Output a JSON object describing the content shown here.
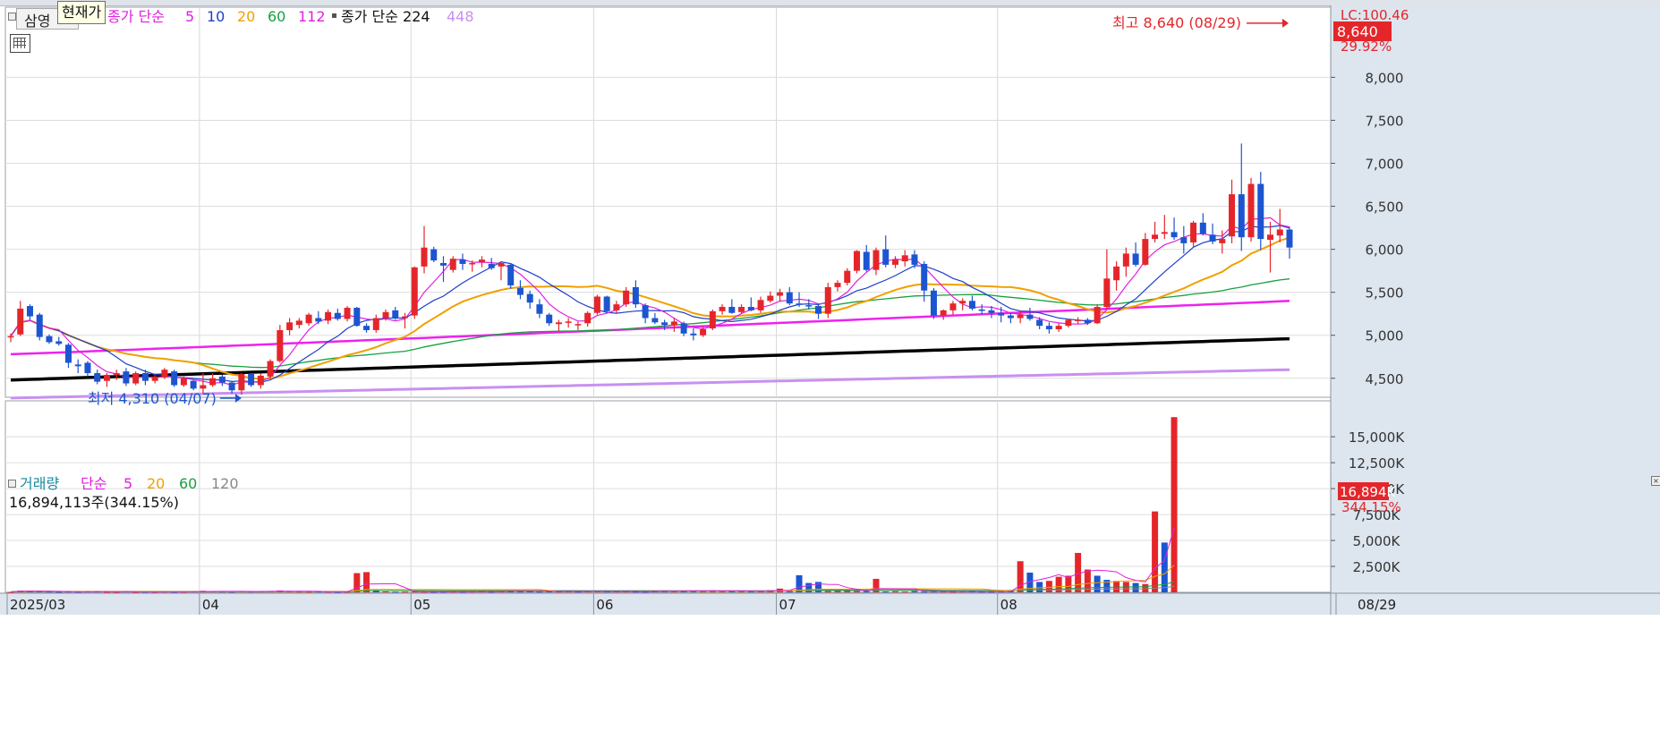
{
  "price_panel": {
    "title": "삼영",
    "tooltip": "현재가",
    "legend_ma_prefix": "종가 단순",
    "legend_ma_periods": [
      {
        "label": "5",
        "color": "#e020e0"
      },
      {
        "label": "10",
        "color": "#1e3fc8"
      },
      {
        "label": "20",
        "color": "#f0a000"
      },
      {
        "label": "60",
        "color": "#18a040"
      },
      {
        "label": "112",
        "color": "#e020e0"
      }
    ],
    "legend_ma2_prefix": "종가 단순 224",
    "legend_ma2_extra": "448",
    "lc_label": "LC:100.46",
    "current_price_badge": "8,640",
    "change_pct": "29.92%",
    "high_annotation": "최고 8,640 (08/29)",
    "low_annotation": "최저 4,310 (04/07)",
    "y_ticks": [
      "8,000",
      "7,500",
      "7,000",
      "6,500",
      "6,000",
      "5,500",
      "5,000",
      "4,500"
    ]
  },
  "volume_panel": {
    "legend_title": "거래량",
    "legend_ma_prefix": "단순",
    "legend_periods": [
      {
        "label": "5",
        "color": "#e020e0"
      },
      {
        "label": "20",
        "color": "#f0a000"
      },
      {
        "label": "60",
        "color": "#18a040"
      },
      {
        "label": "120",
        "color": "#888888"
      }
    ],
    "current_volume_text": "16,894,113주(344.15%)",
    "current_volume_badge": "16,894K",
    "volume_change_pct": "344.15%",
    "y_ticks": [
      "15,000K",
      "12,500K",
      "10,000K",
      "7,500K",
      "5,000K",
      "2,500K"
    ]
  },
  "x_axis": {
    "labels": [
      {
        "text": "2025/03",
        "date": "2025-03-04"
      },
      {
        "text": "04",
        "date": "2025-04-01"
      },
      {
        "text": "05",
        "date": "2025-05-02"
      },
      {
        "text": "06",
        "date": "2025-06-02"
      },
      {
        "text": "07",
        "date": "2025-07-01"
      },
      {
        "text": "08",
        "date": "2025-08-01"
      }
    ],
    "last_date_label": "08/29"
  },
  "colors": {
    "up": "#e4262b",
    "down": "#1c55d0",
    "ma5": "#e020e0",
    "ma10": "#1e3fc8",
    "ma20": "#f0a000",
    "ma60": "#18a040",
    "ma112": "#ee22ee",
    "ma224": "#000000",
    "ma448": "#c890f0",
    "axis_bg": "#dde5ee"
  },
  "chart_data": {
    "type": "candlestick",
    "x_range": [
      "2025-03-04",
      "2025-08-29"
    ],
    "ylim": [
      4200,
      8700
    ],
    "volume_ylim": [
      0,
      17000
    ],
    "volume_unit": "K shares",
    "grid": true,
    "dates": [
      "03-04",
      "03-05",
      "03-06",
      "03-07",
      "03-10",
      "03-11",
      "03-12",
      "03-13",
      "03-14",
      "03-17",
      "03-18",
      "03-19",
      "03-20",
      "03-21",
      "03-24",
      "03-25",
      "03-26",
      "03-27",
      "03-28",
      "03-31",
      "04-01",
      "04-02",
      "04-03",
      "04-04",
      "04-07",
      "04-08",
      "04-09",
      "04-10",
      "04-11",
      "04-14",
      "04-15",
      "04-16",
      "04-17",
      "04-18",
      "04-21",
      "04-22",
      "04-23",
      "04-24",
      "04-25",
      "04-28",
      "04-29",
      "04-30",
      "05-02",
      "05-07",
      "05-08",
      "05-09",
      "05-12",
      "05-13",
      "05-14",
      "05-15",
      "05-16",
      "05-19",
      "05-20",
      "05-21",
      "05-22",
      "05-23",
      "05-26",
      "05-27",
      "05-28",
      "05-29",
      "05-30",
      "06-02",
      "06-04",
      "06-05",
      "06-09",
      "06-10",
      "06-11",
      "06-12",
      "06-13",
      "06-16",
      "06-17",
      "06-18",
      "06-19",
      "06-20",
      "06-23",
      "06-24",
      "06-25",
      "06-26",
      "06-27",
      "06-30",
      "07-01",
      "07-02",
      "07-03",
      "07-04",
      "07-07",
      "07-08",
      "07-09",
      "07-10",
      "07-11",
      "07-14",
      "07-15",
      "07-16",
      "07-17",
      "07-18",
      "07-21",
      "07-22",
      "07-23",
      "07-24",
      "07-25",
      "07-28",
      "07-29",
      "07-30",
      "07-31",
      "08-01",
      "08-04",
      "08-05",
      "08-06",
      "08-07",
      "08-08",
      "08-11",
      "08-12",
      "08-13",
      "08-14",
      "08-18",
      "08-19",
      "08-20",
      "08-21",
      "08-22",
      "08-25",
      "08-26",
      "08-27",
      "08-28",
      "08-29"
    ],
    "ohlc": [
      [
        4980,
        5020,
        4920,
        4990
      ],
      [
        5010,
        5400,
        4990,
        5310
      ],
      [
        5340,
        5360,
        5180,
        5220
      ],
      [
        5240,
        5260,
        4940,
        4980
      ],
      [
        4990,
        5010,
        4900,
        4920
      ],
      [
        4930,
        4980,
        4880,
        4900
      ],
      [
        4890,
        4910,
        4620,
        4680
      ],
      [
        4660,
        4720,
        4560,
        4640
      ],
      [
        4680,
        4700,
        4520,
        4560
      ],
      [
        4560,
        4600,
        4430,
        4460
      ],
      [
        4470,
        4560,
        4400,
        4540
      ],
      [
        4540,
        4600,
        4480,
        4560
      ],
      [
        4580,
        4620,
        4410,
        4440
      ],
      [
        4440,
        4580,
        4420,
        4560
      ],
      [
        4560,
        4600,
        4420,
        4470
      ],
      [
        4470,
        4540,
        4440,
        4520
      ],
      [
        4510,
        4620,
        4490,
        4600
      ],
      [
        4580,
        4600,
        4400,
        4420
      ],
      [
        4420,
        4520,
        4400,
        4500
      ],
      [
        4470,
        4480,
        4360,
        4380
      ],
      [
        4380,
        4560,
        4330,
        4420
      ],
      [
        4420,
        4560,
        4400,
        4500
      ],
      [
        4520,
        4540,
        4410,
        4450
      ],
      [
        4450,
        4470,
        4320,
        4360
      ],
      [
        4360,
        4560,
        4310,
        4550
      ],
      [
        4550,
        4560,
        4400,
        4420
      ],
      [
        4420,
        4560,
        4380,
        4530
      ],
      [
        4520,
        4720,
        4500,
        4700
      ],
      [
        4700,
        5120,
        4680,
        5060
      ],
      [
        5060,
        5200,
        5000,
        5150
      ],
      [
        5120,
        5200,
        5080,
        5170
      ],
      [
        5140,
        5260,
        5110,
        5240
      ],
      [
        5200,
        5280,
        5130,
        5160
      ],
      [
        5170,
        5300,
        5130,
        5270
      ],
      [
        5260,
        5310,
        5170,
        5190
      ],
      [
        5190,
        5340,
        5160,
        5320
      ],
      [
        5320,
        5330,
        5100,
        5110
      ],
      [
        5110,
        5140,
        5030,
        5060
      ],
      [
        5060,
        5240,
        5030,
        5200
      ],
      [
        5200,
        5300,
        5170,
        5270
      ],
      [
        5290,
        5330,
        5180,
        5200
      ],
      [
        5200,
        5260,
        5080,
        5220
      ],
      [
        5230,
        5800,
        5190,
        5790
      ],
      [
        5800,
        6270,
        5720,
        6020
      ],
      [
        6000,
        6030,
        5850,
        5870
      ],
      [
        5840,
        5920,
        5620,
        5810
      ],
      [
        5760,
        5920,
        5730,
        5890
      ],
      [
        5880,
        5950,
        5760,
        5830
      ],
      [
        5830,
        5870,
        5740,
        5840
      ],
      [
        5850,
        5920,
        5790,
        5880
      ],
      [
        5830,
        5900,
        5760,
        5780
      ],
      [
        5800,
        5850,
        5640,
        5840
      ],
      [
        5820,
        5840,
        5540,
        5580
      ],
      [
        5550,
        5640,
        5420,
        5470
      ],
      [
        5480,
        5520,
        5310,
        5380
      ],
      [
        5360,
        5420,
        5200,
        5250
      ],
      [
        5240,
        5260,
        5110,
        5140
      ],
      [
        5130,
        5180,
        5050,
        5150
      ],
      [
        5150,
        5200,
        5090,
        5160
      ],
      [
        5130,
        5160,
        5060,
        5130
      ],
      [
        5140,
        5280,
        5100,
        5260
      ],
      [
        5260,
        5470,
        5240,
        5450
      ],
      [
        5450,
        5460,
        5270,
        5280
      ],
      [
        5290,
        5400,
        5260,
        5360
      ],
      [
        5360,
        5560,
        5330,
        5520
      ],
      [
        5560,
        5640,
        5320,
        5360
      ],
      [
        5350,
        5370,
        5140,
        5200
      ],
      [
        5200,
        5260,
        5130,
        5150
      ],
      [
        5150,
        5180,
        5060,
        5120
      ],
      [
        5120,
        5200,
        5040,
        5160
      ],
      [
        5140,
        5160,
        4990,
        5020
      ],
      [
        5020,
        5080,
        4940,
        5000
      ],
      [
        5000,
        5110,
        4980,
        5070
      ],
      [
        5080,
        5300,
        5060,
        5280
      ],
      [
        5280,
        5360,
        5240,
        5330
      ],
      [
        5330,
        5420,
        5250,
        5260
      ],
      [
        5270,
        5360,
        5250,
        5330
      ],
      [
        5330,
        5440,
        5280,
        5290
      ],
      [
        5290,
        5450,
        5260,
        5410
      ],
      [
        5400,
        5510,
        5380,
        5460
      ],
      [
        5460,
        5540,
        5390,
        5500
      ],
      [
        5500,
        5560,
        5350,
        5370
      ],
      [
        5370,
        5500,
        5330,
        5360
      ],
      [
        5350,
        5420,
        5300,
        5340
      ],
      [
        5340,
        5370,
        5190,
        5250
      ],
      [
        5250,
        5610,
        5200,
        5560
      ],
      [
        5560,
        5640,
        5510,
        5610
      ],
      [
        5610,
        5780,
        5580,
        5750
      ],
      [
        5750,
        5990,
        5720,
        5980
      ],
      [
        5970,
        6050,
        5740,
        5760
      ],
      [
        5760,
        6020,
        5700,
        5990
      ],
      [
        6000,
        6160,
        5790,
        5820
      ],
      [
        5820,
        5920,
        5780,
        5880
      ],
      [
        5860,
        5990,
        5800,
        5930
      ],
      [
        5940,
        5990,
        5780,
        5820
      ],
      [
        5830,
        5860,
        5390,
        5520
      ],
      [
        5520,
        5550,
        5190,
        5230
      ],
      [
        5230,
        5300,
        5180,
        5290
      ],
      [
        5290,
        5400,
        5240,
        5370
      ],
      [
        5370,
        5430,
        5290,
        5400
      ],
      [
        5400,
        5460,
        5290,
        5310
      ],
      [
        5300,
        5360,
        5240,
        5290
      ],
      [
        5290,
        5340,
        5200,
        5260
      ],
      [
        5260,
        5330,
        5150,
        5230
      ],
      [
        5230,
        5260,
        5140,
        5200
      ],
      [
        5200,
        5290,
        5140,
        5240
      ],
      [
        5240,
        5320,
        5170,
        5190
      ],
      [
        5180,
        5210,
        5070,
        5110
      ],
      [
        5110,
        5150,
        5020,
        5070
      ],
      [
        5070,
        5140,
        5040,
        5110
      ],
      [
        5110,
        5190,
        5090,
        5180
      ],
      [
        5180,
        5210,
        5130,
        5180
      ],
      [
        5180,
        5200,
        5120,
        5140
      ],
      [
        5140,
        5360,
        5130,
        5330
      ],
      [
        5330,
        6000,
        5300,
        5660
      ],
      [
        5640,
        5860,
        5520,
        5800
      ],
      [
        5800,
        6020,
        5680,
        5950
      ],
      [
        5950,
        6080,
        5800,
        5820
      ],
      [
        5820,
        6190,
        5810,
        6120
      ],
      [
        6120,
        6320,
        6080,
        6170
      ],
      [
        6180,
        6400,
        6120,
        6200
      ],
      [
        6200,
        6370,
        6110,
        6140
      ],
      [
        6140,
        6270,
        5950,
        6070
      ],
      [
        6080,
        6330,
        6020,
        6310
      ],
      [
        6310,
        6420,
        6160,
        6180
      ],
      [
        6170,
        6300,
        6060,
        6090
      ],
      [
        6070,
        6220,
        5950,
        6120
      ],
      [
        6150,
        6810,
        6070,
        6640
      ],
      [
        6640,
        7230,
        5980,
        6140
      ],
      [
        6140,
        6830,
        6090,
        6760
      ],
      [
        6760,
        6900,
        5990,
        6120
      ],
      [
        6110,
        6320,
        5730,
        6170
      ],
      [
        6160,
        6470,
        6080,
        6230
      ],
      [
        6230,
        6260,
        5890,
        6020
      ]
    ],
    "volume": [
      40,
      160,
      110,
      90,
      70,
      50,
      80,
      60,
      90,
      120,
      50,
      40,
      90,
      40,
      60,
      50,
      70,
      50,
      60,
      90,
      150,
      100,
      70,
      50,
      120,
      80,
      100,
      120,
      180,
      80,
      70,
      60,
      80,
      70,
      50,
      60,
      1850,
      1950,
      150,
      90,
      60,
      70,
      80,
      60,
      50,
      60,
      70,
      60,
      80,
      110,
      60,
      90,
      160,
      80,
      120,
      60,
      100,
      80,
      120,
      70,
      90,
      110,
      80,
      100,
      90,
      70,
      60,
      150,
      180,
      120,
      90,
      130,
      150,
      200,
      110,
      90,
      130,
      80,
      100,
      210,
      360,
      180,
      1650,
      900,
      1000,
      120,
      130,
      140,
      120,
      100,
      1300,
      90,
      110,
      80,
      120,
      60,
      100,
      80,
      60,
      90,
      100,
      70,
      60,
      80,
      120,
      3000,
      1900,
      1000,
      1100,
      1500,
      1600,
      3800,
      2200,
      1600,
      1200,
      1100,
      1000,
      900,
      800,
      7800,
      4800,
      16894
    ],
    "volume_up": [
      true,
      true,
      false,
      false,
      false,
      false,
      false,
      false,
      false,
      false,
      true,
      true,
      false,
      true,
      false,
      true,
      true,
      false,
      true,
      false,
      true,
      true,
      false,
      false,
      true,
      false,
      true,
      true,
      true,
      true,
      true,
      true,
      false,
      true,
      false,
      true,
      true,
      true,
      false,
      true,
      false,
      true,
      true,
      true,
      false,
      false,
      true,
      false,
      true,
      true,
      false,
      true,
      false,
      false,
      false,
      false,
      false,
      true,
      true,
      false,
      true,
      true,
      false,
      true,
      true,
      false,
      false,
      false,
      false,
      true,
      false,
      false,
      true,
      true,
      true,
      false,
      true,
      false,
      true,
      true,
      true,
      false,
      false,
      false,
      false,
      true,
      true,
      true,
      true,
      false,
      true,
      false,
      true,
      true,
      false,
      false,
      false,
      true,
      true,
      true,
      false,
      false,
      false,
      false,
      false,
      true,
      false,
      false,
      true,
      true,
      true,
      true,
      true,
      false,
      false,
      true,
      true,
      false,
      true,
      true,
      false,
      true,
      true
    ],
    "series": [
      {
        "name": "종가 단순 224",
        "values_start": 4480,
        "values_end": 4960
      },
      {
        "name": "448",
        "values_start": 4270,
        "values_end": 4600
      }
    ]
  }
}
